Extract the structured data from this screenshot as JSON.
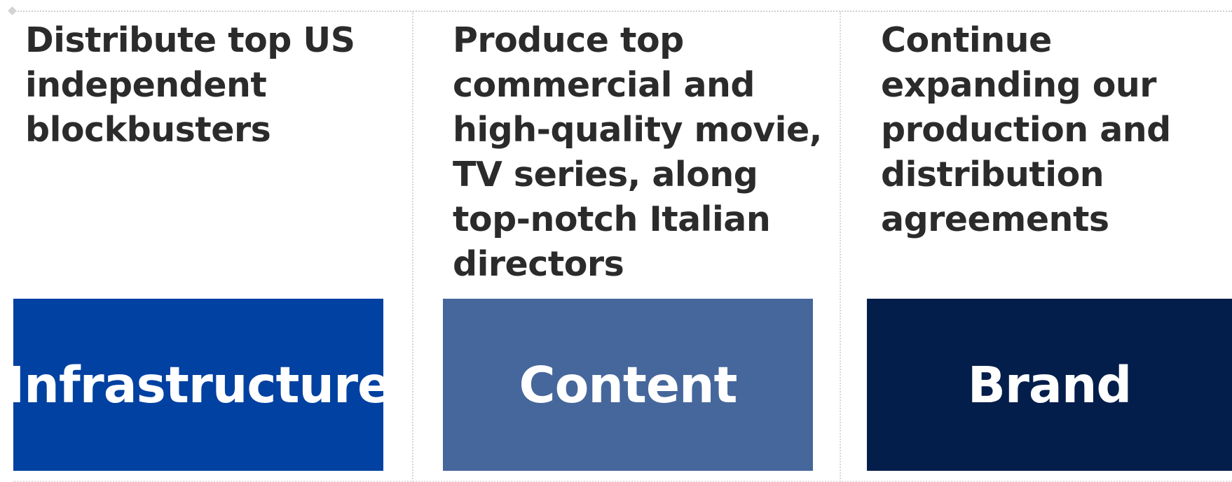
{
  "columns": [
    {
      "description": "Distribute top US\nindependent\nblockbusters",
      "label": "Infrastructure",
      "color": "#0041a1"
    },
    {
      "description": "Produce top\ncommercial and\nhigh-quality movie,\nTV series, along\ntop-notch Italian\ndirectors",
      "label": "Content",
      "color": "#46679b"
    },
    {
      "description": "Continue\nexpanding our\nproduction and\ndistribution\nagreements",
      "label": "Brand",
      "color": "#041e4c"
    }
  ]
}
